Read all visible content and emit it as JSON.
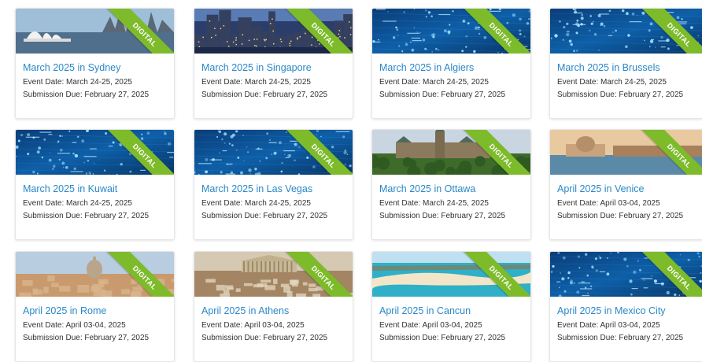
{
  "colors": {
    "title": "#2a88c8",
    "ribbon": "#7dbb2a",
    "text": "#333333"
  },
  "cards": [
    {
      "title": "March 2025 in Sydney",
      "event_date": "Event Date: March 24-25, 2025",
      "submission_due": "Submission Due: February 27, 2025",
      "badge": "DIGITAL",
      "image": "sydney-harbour"
    },
    {
      "title": "March 2025 in Singapore",
      "event_date": "Event Date: March 24-25, 2025",
      "submission_due": "Submission Due: February 27, 2025",
      "badge": "DIGITAL",
      "image": "singapore-skyline"
    },
    {
      "title": "March 2025 in Algiers",
      "event_date": "Event Date: March 24-25, 2025",
      "submission_due": "Submission Due: February 27, 2025",
      "badge": "DIGITAL",
      "image": "digital-network"
    },
    {
      "title": "March 2025 in Brussels",
      "event_date": "Event Date: March 24-25, 2025",
      "submission_due": "Submission Due: February 27, 2025",
      "badge": "DIGITAL",
      "image": "digital-network"
    },
    {
      "title": "March 2025 in Kuwait",
      "event_date": "Event Date: March 24-25, 2025",
      "submission_due": "Submission Due: February 27, 2025",
      "badge": "DIGITAL",
      "image": "digital-network"
    },
    {
      "title": "March 2025 in Las Vegas",
      "event_date": "Event Date: March 24-25, 2025",
      "submission_due": "Submission Due: February 27, 2025",
      "badge": "DIGITAL",
      "image": "digital-network"
    },
    {
      "title": "March 2025 in Ottawa",
      "event_date": "Event Date: March 24-25, 2025",
      "submission_due": "Submission Due: February 27, 2025",
      "badge": "DIGITAL",
      "image": "ottawa-parliament"
    },
    {
      "title": "April 2025 in Venice",
      "event_date": "Event Date: April 03-04, 2025",
      "submission_due": "Submission Due: February 27, 2025",
      "badge": "DIGITAL",
      "image": "venice-canal"
    },
    {
      "title": "April 2025 in Rome",
      "event_date": "Event Date: April 03-04, 2025",
      "submission_due": "Submission Due: February 27, 2025",
      "badge": "DIGITAL",
      "image": "rome-skyline"
    },
    {
      "title": "April 2025 in Athens",
      "event_date": "Event Date: April 03-04, 2025",
      "submission_due": "Submission Due: February 27, 2025",
      "badge": "DIGITAL",
      "image": "athens-acropolis"
    },
    {
      "title": "April 2025 in Cancun",
      "event_date": "Event Date: April 03-04, 2025",
      "submission_due": "Submission Due: February 27, 2025",
      "badge": "DIGITAL",
      "image": "cancun-beach"
    },
    {
      "title": "April 2025 in Mexico City",
      "event_date": "Event Date: April 03-04, 2025",
      "submission_due": "Submission Due: February 27, 2025",
      "badge": "DIGITAL",
      "image": "digital-network"
    }
  ]
}
